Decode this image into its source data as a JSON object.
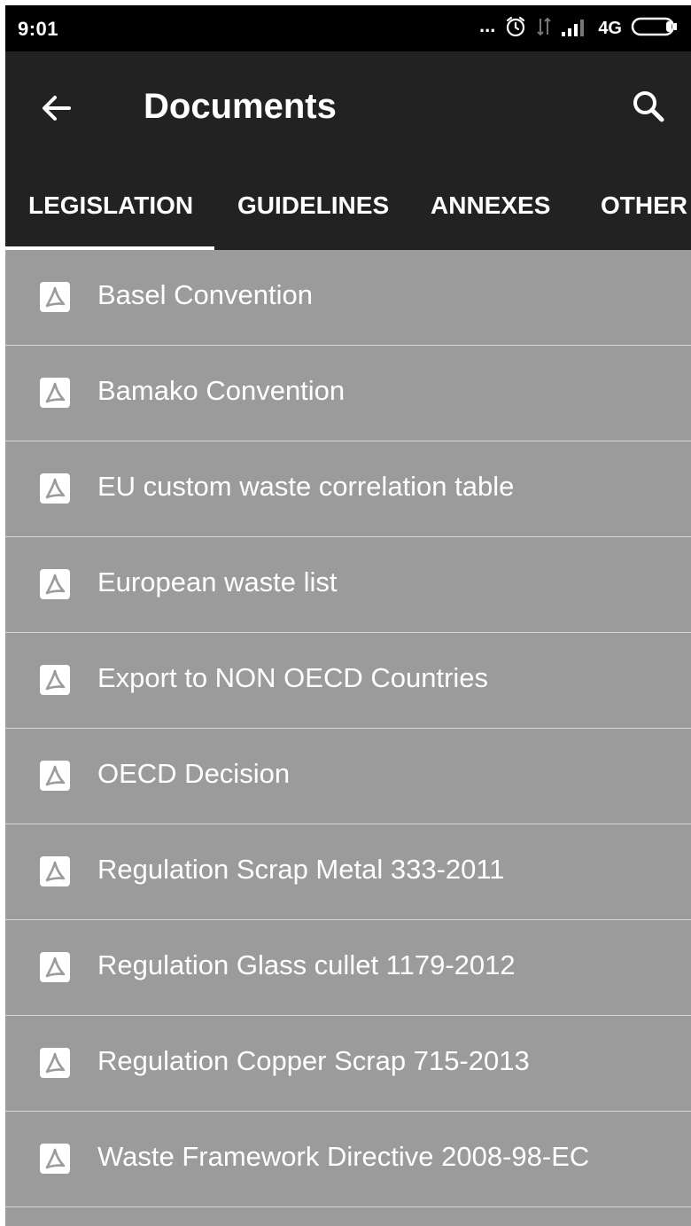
{
  "status_bar": {
    "time": "9:01",
    "dots": "...",
    "network": "4G",
    "icons": [
      "alarm-icon",
      "data-arrows-icon",
      "signal-icon",
      "battery-icon"
    ]
  },
  "app_bar": {
    "title": "Documents",
    "back_icon": "arrow-left-icon",
    "search_icon": "search-icon",
    "background": "#222222"
  },
  "tabs": [
    {
      "label": "LEGISLATION",
      "selected": true
    },
    {
      "label": "GUIDELINES",
      "selected": false
    },
    {
      "label": "ANNEXES",
      "selected": false
    },
    {
      "label": "OTHER",
      "selected": false
    }
  ],
  "documents": [
    {
      "label": "Basel Convention",
      "icon": "pdf-icon"
    },
    {
      "label": "Bamako Convention",
      "icon": "pdf-icon"
    },
    {
      "label": "EU custom waste correlation table",
      "icon": "pdf-icon"
    },
    {
      "label": "European waste list",
      "icon": "pdf-icon"
    },
    {
      "label": "Export to NON OECD Countries",
      "icon": "pdf-icon"
    },
    {
      "label": "OECD Decision",
      "icon": "pdf-icon"
    },
    {
      "label": "Regulation Scrap Metal 333-2011",
      "icon": "pdf-icon"
    },
    {
      "label": "Regulation Glass cullet 1179-2012",
      "icon": "pdf-icon"
    },
    {
      "label": "Regulation Copper Scrap 715-2013",
      "icon": "pdf-icon"
    },
    {
      "label": "Waste Framework Directive 2008-98-EC",
      "icon": "pdf-icon"
    }
  ],
  "colors": {
    "status_bar": "#000000",
    "list_background": "#9b9b9b",
    "divider": "#d6d6d6",
    "text": "#ffffff"
  }
}
